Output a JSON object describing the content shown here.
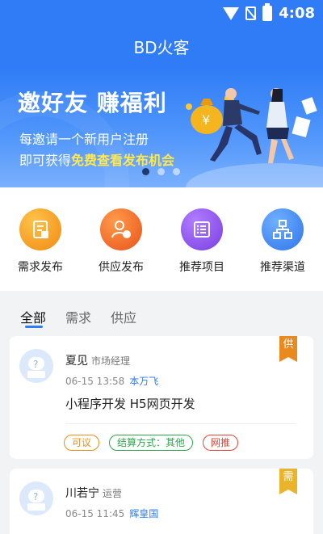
{
  "status_bar": {
    "time": "4:08",
    "icons": [
      "wifi-icon",
      "no-sim-icon",
      "battery-charging-icon"
    ]
  },
  "app": {
    "title": "BD火客"
  },
  "banner": {
    "headline": "邀好友 赚福利",
    "line1": "每邀请一个新用户注册",
    "line2_prefix": "即可获得",
    "line2_highlight": "免费查看发布机会",
    "highlight_color": "#ffe84d",
    "page_indicator": {
      "total": 3,
      "active": 1
    }
  },
  "quick_actions": [
    {
      "label": "需求发布",
      "icon": "demand-doc-icon",
      "color": "#f39a1e"
    },
    {
      "label": "供应发布",
      "icon": "supply-user-icon",
      "color": "#f06b2a"
    },
    {
      "label": "推荐项目",
      "icon": "project-list-icon",
      "color": "#8b56e8"
    },
    {
      "label": "推荐渠道",
      "icon": "channel-network-icon",
      "color": "#3d86f2"
    }
  ],
  "tabs": [
    {
      "label": "全部",
      "active": true
    },
    {
      "label": "需求",
      "active": false
    },
    {
      "label": "供应",
      "active": false
    }
  ],
  "cards": [
    {
      "ribbon": "供",
      "name": "夏见",
      "role": "市场经理",
      "time": "06-15 13:58",
      "org": "本万飞",
      "title": "小程序开发 H5网页开发",
      "tags": [
        {
          "text": "可议",
          "color": "orange"
        },
        {
          "text": "结算方式：其他",
          "color": "green"
        },
        {
          "text": "网推",
          "color": "red"
        }
      ]
    },
    {
      "ribbon": "需",
      "name": "川若宁",
      "role": "运营",
      "time": "06-15 11:45",
      "org": "辉皇国"
    }
  ],
  "colors": {
    "primary": "#2f7cf6",
    "background": "#f2f3f5"
  }
}
